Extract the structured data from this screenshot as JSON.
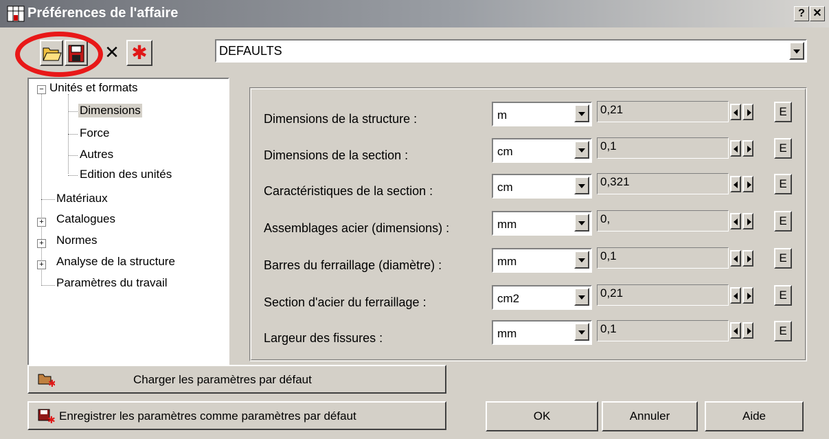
{
  "window": {
    "title": "Préférences de l'affaire",
    "help_btn": "?",
    "close_btn": "✕"
  },
  "toolbar": {
    "icons": [
      "open-folder-icon",
      "save-disk-icon",
      "delete-x-icon",
      "new-star-icon"
    ],
    "delete_glyph": "✕",
    "new_glyph": "✱"
  },
  "profile": {
    "value": "DEFAULTS"
  },
  "tree": {
    "items": [
      {
        "label": "Unités et formats",
        "expander": "−"
      },
      {
        "label": "Dimensions"
      },
      {
        "label": "Force"
      },
      {
        "label": "Autres"
      },
      {
        "label": "Edition des unités"
      },
      {
        "label": "Matériaux"
      },
      {
        "label": "Catalogues",
        "expander": "+"
      },
      {
        "label": "Normes",
        "expander": "+"
      },
      {
        "label": "Analyse de la structure",
        "expander": "+"
      },
      {
        "label": "Paramètres du travail"
      }
    ]
  },
  "units": {
    "rows": [
      {
        "label": "Dimensions de la structure :",
        "unit": "m",
        "value": "0,21"
      },
      {
        "label": "Dimensions de la section :",
        "unit": "cm",
        "value": "0,1"
      },
      {
        "label": "Caractéristiques de la section :",
        "unit": "cm",
        "value": "0,321"
      },
      {
        "label": "Assemblages acier (dimensions) :",
        "unit": "mm",
        "value": "0,"
      },
      {
        "label": "Barres du ferraillage (diamètre) :",
        "unit": "mm",
        "value": "0,1"
      },
      {
        "label": "Section d'acier du ferraillage :",
        "unit": "cm2",
        "value": "0,21"
      },
      {
        "label": "Largeur des fissures :",
        "unit": "mm",
        "value": "0,1"
      }
    ],
    "e_label": "E"
  },
  "buttons": {
    "load_defaults": "Charger les paramètres par défaut",
    "save_defaults": "Enregistrer les paramètres comme paramètres par défaut",
    "ok": "OK",
    "cancel": "Annuler",
    "help": "Aide"
  },
  "colors": {
    "dialog_bg": "#d4d0c8",
    "highlight_circle": "#e81818"
  }
}
